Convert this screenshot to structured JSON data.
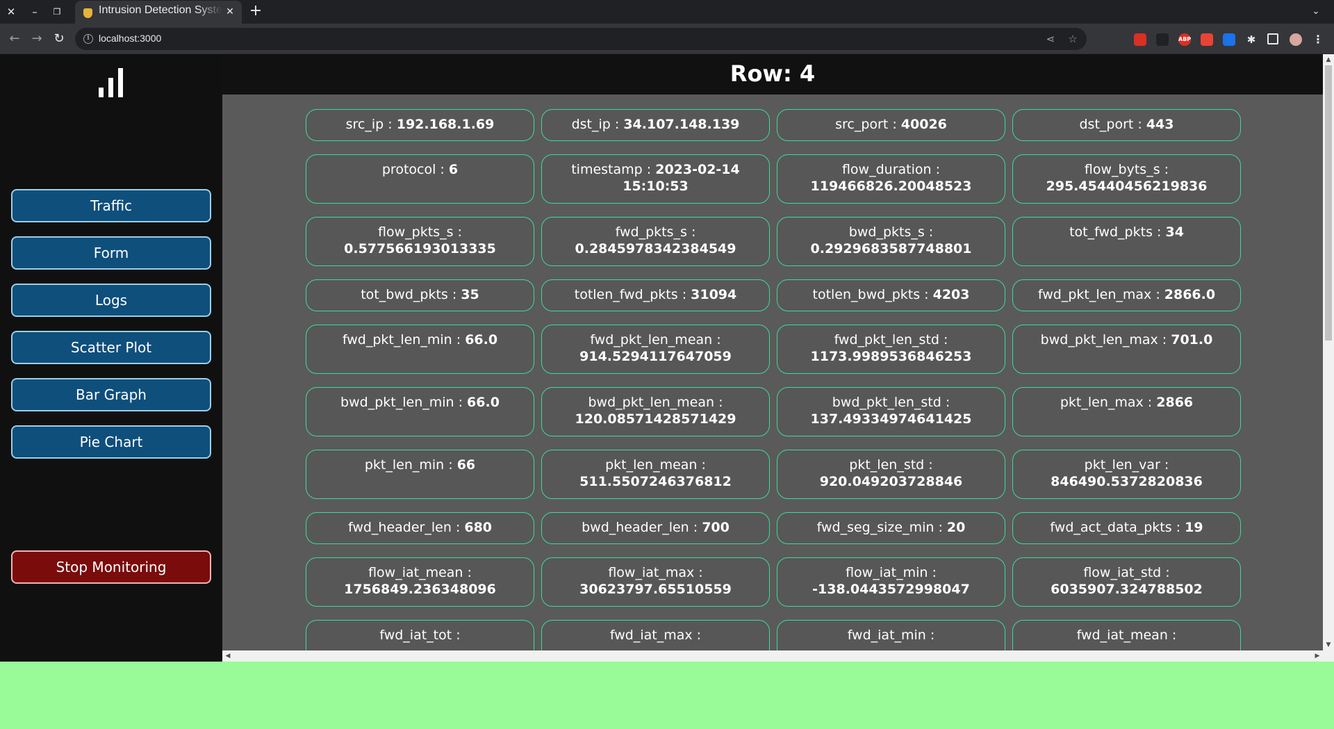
{
  "browser": {
    "tab_title": "Intrusion Detection System",
    "url": "localhost:3000",
    "extensions": [
      "gallery-ext-icon",
      "ghost-ext-icon",
      "abp-ext-icon",
      "shield-ext-icon",
      "translate-ext-icon"
    ],
    "extension_colors": [
      "#d93025",
      "#202124",
      "#d93025",
      "#ea4335",
      "#1a73e8"
    ]
  },
  "sidebar": {
    "nav": [
      {
        "label": "Traffic"
      },
      {
        "label": "Form"
      },
      {
        "label": "Logs"
      },
      {
        "label": "Scatter Plot"
      },
      {
        "label": "Bar Graph"
      },
      {
        "label": "Pie Chart"
      }
    ],
    "stop_label": "Stop Monitoring"
  },
  "main": {
    "title": "Row: 4",
    "fields": [
      {
        "key": "src_ip",
        "value": "192.168.1.69"
      },
      {
        "key": "dst_ip",
        "value": "34.107.148.139"
      },
      {
        "key": "src_port",
        "value": "40026"
      },
      {
        "key": "dst_port",
        "value": "443"
      },
      {
        "key": "protocol",
        "value": "6"
      },
      {
        "key": "timestamp",
        "value": "2023-02-14 15:10:53"
      },
      {
        "key": "flow_duration",
        "value": "119466826.20048523"
      },
      {
        "key": "flow_byts_s",
        "value": "295.45440456219836"
      },
      {
        "key": "flow_pkts_s",
        "value": "0.577566193013335"
      },
      {
        "key": "fwd_pkts_s",
        "value": "0.2845978342384549"
      },
      {
        "key": "bwd_pkts_s",
        "value": "0.2929683587748801"
      },
      {
        "key": "tot_fwd_pkts",
        "value": "34"
      },
      {
        "key": "tot_bwd_pkts",
        "value": "35"
      },
      {
        "key": "totlen_fwd_pkts",
        "value": "31094"
      },
      {
        "key": "totlen_bwd_pkts",
        "value": "4203"
      },
      {
        "key": "fwd_pkt_len_max",
        "value": "2866.0"
      },
      {
        "key": "fwd_pkt_len_min",
        "value": "66.0"
      },
      {
        "key": "fwd_pkt_len_mean",
        "value": "914.5294117647059"
      },
      {
        "key": "fwd_pkt_len_std",
        "value": "1173.9989536846253"
      },
      {
        "key": "bwd_pkt_len_max",
        "value": "701.0"
      },
      {
        "key": "bwd_pkt_len_min",
        "value": "66.0"
      },
      {
        "key": "bwd_pkt_len_mean",
        "value": "120.08571428571429"
      },
      {
        "key": "bwd_pkt_len_std",
        "value": "137.49334974641425"
      },
      {
        "key": "pkt_len_max",
        "value": "2866"
      },
      {
        "key": "pkt_len_min",
        "value": "66"
      },
      {
        "key": "pkt_len_mean",
        "value": "511.5507246376812"
      },
      {
        "key": "pkt_len_std",
        "value": "920.049203728846"
      },
      {
        "key": "pkt_len_var",
        "value": "846490.5372820836"
      },
      {
        "key": "fwd_header_len",
        "value": "680"
      },
      {
        "key": "bwd_header_len",
        "value": "700"
      },
      {
        "key": "fwd_seg_size_min",
        "value": "20"
      },
      {
        "key": "fwd_act_data_pkts",
        "value": "19"
      },
      {
        "key": "flow_iat_mean",
        "value": "1756849.236348096"
      },
      {
        "key": "flow_iat_max",
        "value": "30623797.65510559"
      },
      {
        "key": "flow_iat_min",
        "value": "-138.0443572998047"
      },
      {
        "key": "flow_iat_std",
        "value": "6035907.324788502"
      },
      {
        "key": "fwd_iat_tot",
        "value": ""
      },
      {
        "key": "fwd_iat_max",
        "value": ""
      },
      {
        "key": "fwd_iat_min",
        "value": ""
      },
      {
        "key": "fwd_iat_mean",
        "value": ""
      }
    ]
  },
  "colors": {
    "sidebar_bg": "#101010",
    "nav_button": "#0f4f7c",
    "stop_button": "#7a0c0c",
    "card_border": "#3ddc97",
    "content_bg": "#5a5a5a",
    "desktop_bg": "#98fb98"
  }
}
